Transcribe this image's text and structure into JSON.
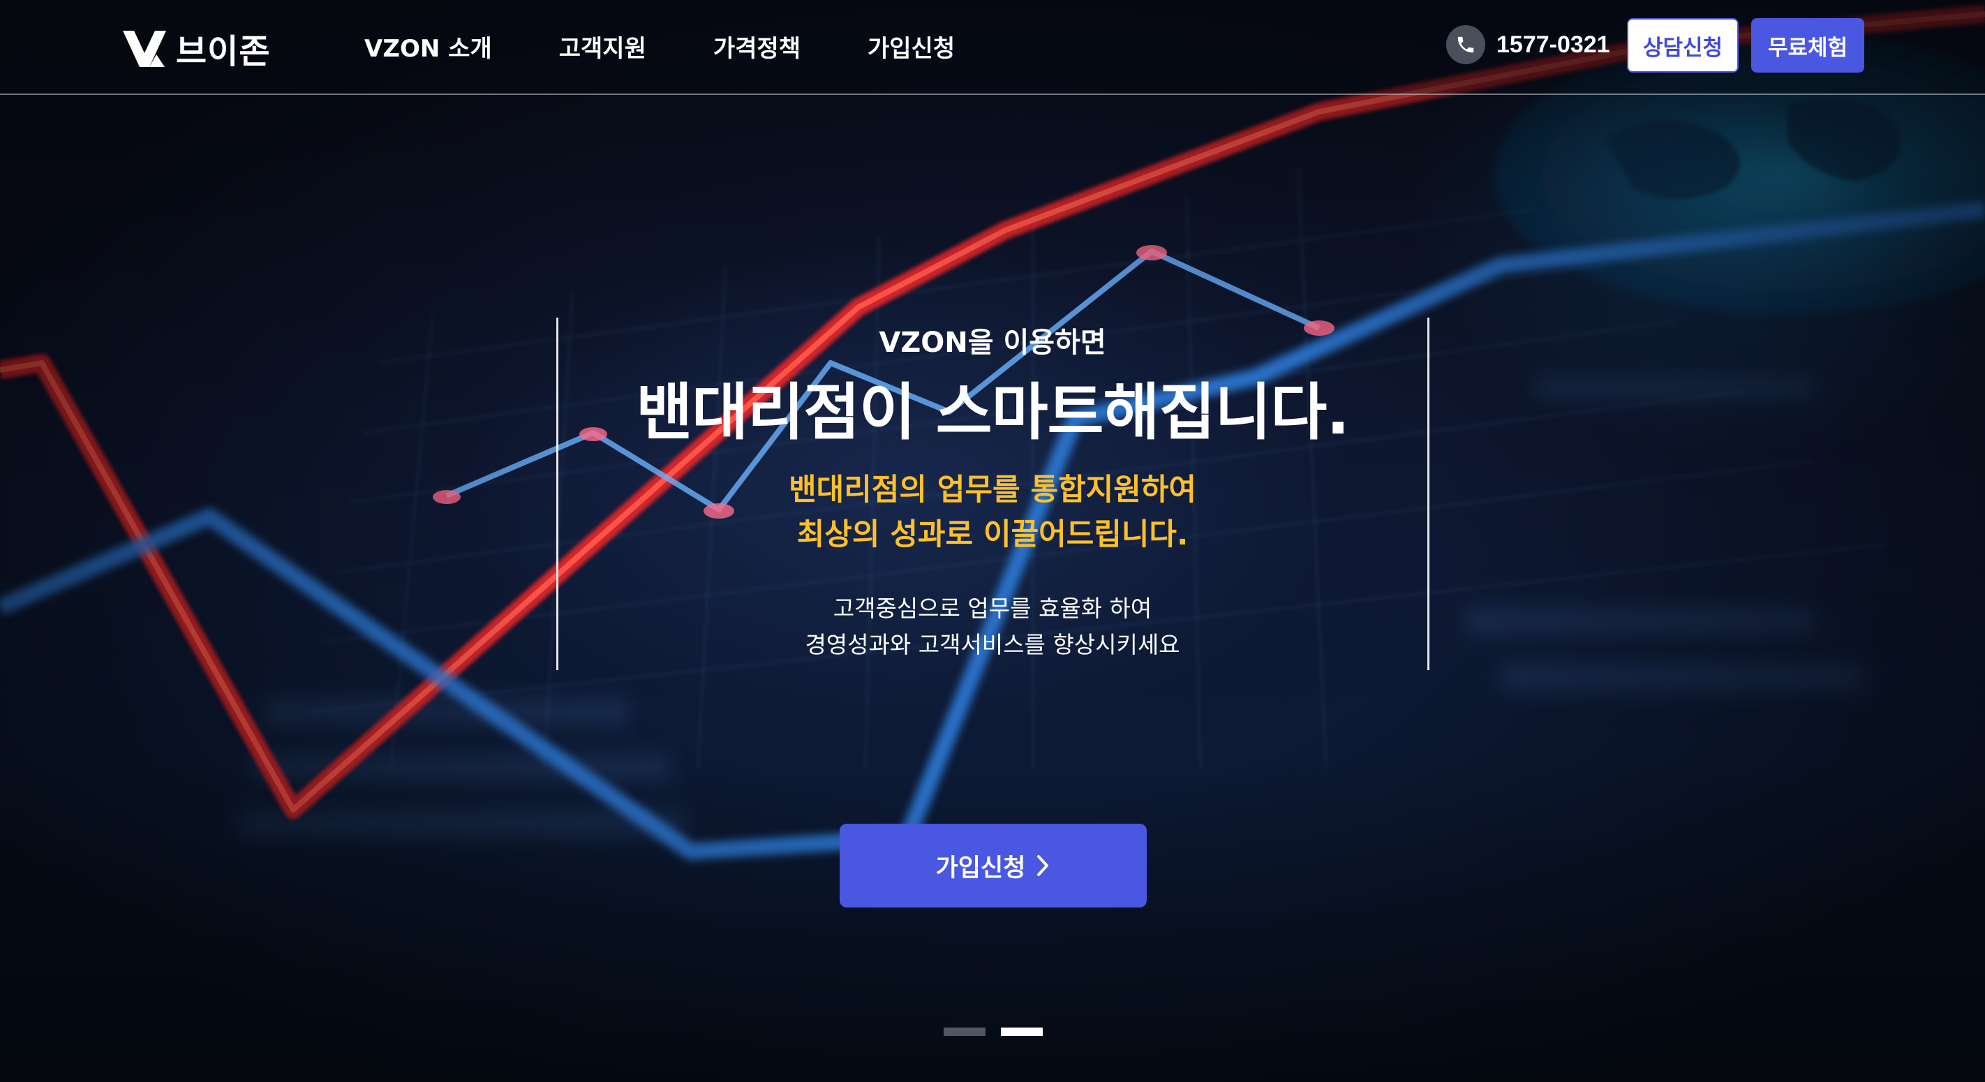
{
  "brand": {
    "logo_letter": "V",
    "name": "브이존"
  },
  "nav": {
    "items": [
      {
        "label": "VZON 소개"
      },
      {
        "label": "고객지원"
      },
      {
        "label": "가격정책"
      },
      {
        "label": "가입신청"
      }
    ]
  },
  "header_actions": {
    "phone_icon": "phone-icon",
    "phone_number": "1577-0321",
    "consult_label": "상담신청",
    "trial_label": "무료체험"
  },
  "hero": {
    "pre_title": "VZON을 이용하면",
    "title": "밴대리점이 스마트해집니다.",
    "highlight_line1": "밴대리점의 업무를 통합지원하여",
    "highlight_line2": "최상의 성과로 이끌어드립니다.",
    "desc_line1": "고객중심으로 업무를 효율화 하여",
    "desc_line2": "경영성과와 고객서비스를 향상시키세요",
    "cta_label": "가입신청",
    "cta_icon": "chevron-right-icon"
  },
  "slider": {
    "total": 2,
    "active_index": 1
  },
  "colors": {
    "accent": "#4a57e0",
    "highlight": "#ffc02a",
    "header_bg": "#0b0f1c"
  }
}
